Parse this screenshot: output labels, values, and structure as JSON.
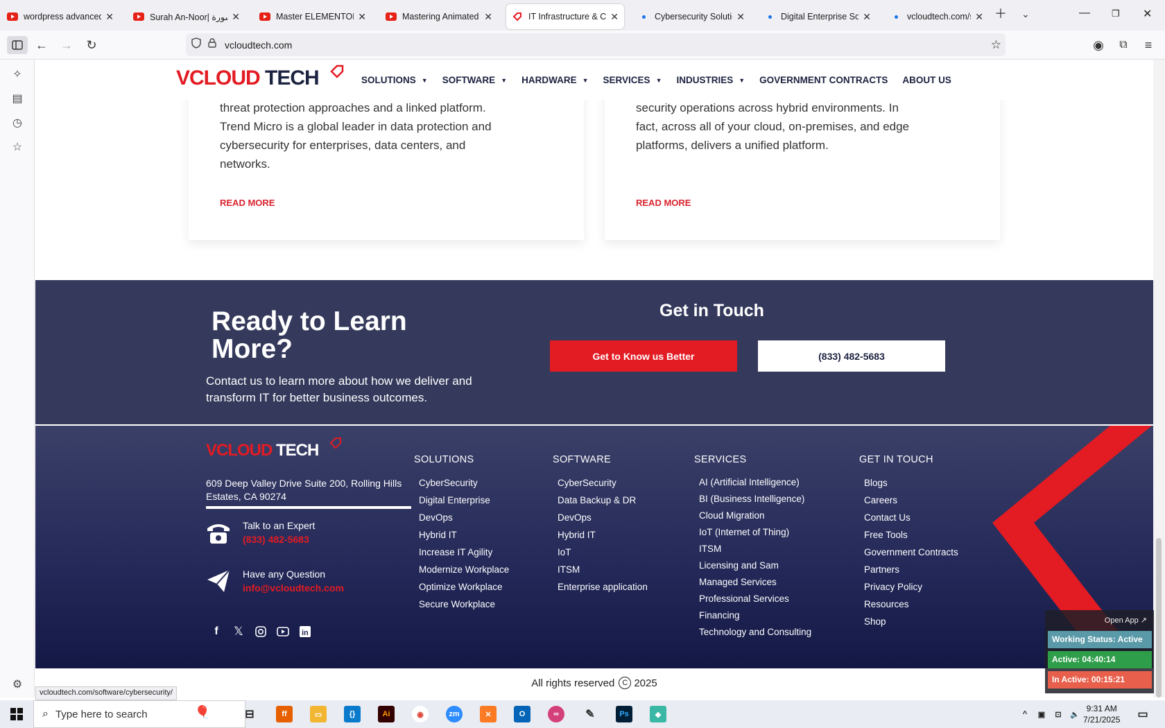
{
  "browser": {
    "tabs": [
      {
        "title": "wordpress advanced ar",
        "icon": "youtube-icon"
      },
      {
        "title": "Surah An-Noor| سورة",
        "icon": "youtube-icon"
      },
      {
        "title": "Master ELEMENTOR: Bu",
        "icon": "youtube-icon"
      },
      {
        "title": "Mastering Animated La",
        "icon": "youtube-icon"
      },
      {
        "title": "IT Infrastructure & Cybe",
        "icon": "vcloudtech-icon",
        "active": true
      },
      {
        "title": "Cybersecurity Solutions",
        "icon": "loading-dot-icon"
      },
      {
        "title": "Digital Enterprise Soluti",
        "icon": "loading-dot-icon"
      },
      {
        "title": "vcloudtech.com/sc",
        "icon": "loading-dot-icon"
      }
    ],
    "url": "vcloudtech.com",
    "status_link": "vcloudtech.com/software/cybersecurity/"
  },
  "site": {
    "logo": {
      "v": "V",
      "text1": "CLOUD",
      "text2": "TECH"
    },
    "menu": [
      {
        "label": "SOLUTIONS",
        "caret": true
      },
      {
        "label": "SOFTWARE",
        "caret": true
      },
      {
        "label": "HARDWARE",
        "caret": true
      },
      {
        "label": "SERVICES",
        "caret": true
      },
      {
        "label": "INDUSTRIES",
        "caret": true
      },
      {
        "label": "GOVERNMENT CONTRACTS",
        "caret": false
      },
      {
        "label": "ABOUT US",
        "caret": false
      }
    ],
    "cards": [
      {
        "text": "threat protection approaches and a linked platform. Trend Micro is a global leader in data protection and cybersecurity for enterprises, data centers, and networks.",
        "link": "READ MORE"
      },
      {
        "text": "security operations across hybrid environments. In fact, across all of your cloud, on-premises, and edge platforms, delivers a unified platform.",
        "link": "READ MORE"
      }
    ],
    "cta": {
      "heading": "Ready to Learn More?",
      "sub": "Contact us to learn more about how we deliver and transform IT for better business outcomes.",
      "get_in_touch": "Get in Touch",
      "btn_primary": "Get to Know us Better",
      "btn_phone": "(833) 482-5683"
    },
    "footer": {
      "address": "609 Deep Valley Drive Suite 200, Rolling Hills Estates, CA 90274",
      "talk_label": "Talk to an Expert",
      "talk_value": "(833) 482-5683",
      "question_label": "Have any Question",
      "question_value": "info@vcloudtech.com",
      "socials": [
        "facebook-icon",
        "x-icon",
        "instagram-icon",
        "youtube-icon",
        "linkedin-icon"
      ],
      "columns": [
        {
          "title": "SOLUTIONS",
          "items": [
            "CyberSecurity",
            "Digital Enterprise",
            "DevOps",
            "Hybrid IT",
            "Increase IT Agility",
            "Modernize Workplace",
            "Optimize Workplace",
            "Secure Workplace"
          ]
        },
        {
          "title": "SOFTWARE",
          "items": [
            "CyberSecurity",
            "Data Backup & DR",
            "DevOps",
            "Hybrid IT",
            "IoT",
            "ITSM",
            "Enterprise application"
          ]
        },
        {
          "title": "SERVICES",
          "items": [
            "AI (Artificial Intelligence)",
            "BI (Business Intelligence)",
            "Cloud Migration",
            "IoT (Internet of Thing)",
            "ITSM",
            "Licensing and Sam",
            "Managed Services",
            "Professional Services",
            "Financing",
            "Technology and Consulting"
          ]
        },
        {
          "title": "GET IN TOUCH",
          "items": [
            "Blogs",
            "Careers",
            "Contact Us",
            "Free Tools",
            "Government Contracts",
            "Partners",
            "Privacy Policy",
            "Resources",
            "Shop"
          ]
        }
      ],
      "copyright": "All rights reserved",
      "year": "2025"
    }
  },
  "widget": {
    "open_app": "Open App ↗",
    "status": "Working Status: Active",
    "active": "Active: 04:40:14",
    "inactive": "In Active: 00:15:21",
    "colors": {
      "status": "#5a9aa8",
      "active": "#2e9e4a",
      "inactive": "#e8604c"
    }
  },
  "taskbar": {
    "search_placeholder": "Type here to search",
    "time": "9:31 AM",
    "date": "7/21/2025"
  },
  "colors": {
    "brand_red": "#e31b23",
    "navy": "#1c2340",
    "cta_bg": "#353a5c"
  }
}
